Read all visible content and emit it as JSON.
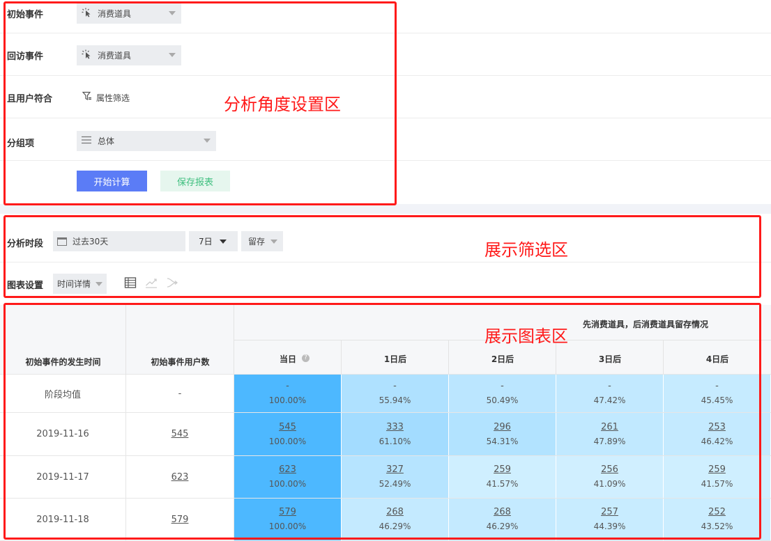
{
  "config": {
    "initial_event": {
      "label": "初始事件",
      "value": "消费道具"
    },
    "return_event": {
      "label": "回访事件",
      "value": "消费道具"
    },
    "user_filter": {
      "label": "且用户符合",
      "link": "属性筛选"
    },
    "group_by": {
      "label": "分组项",
      "value": "总体"
    },
    "buttons": {
      "calculate": "开始计算",
      "save": "保存报表"
    }
  },
  "filters": {
    "period": {
      "label": "分析时段",
      "range": "过去30天",
      "unit": "7日",
      "type": "留存"
    },
    "chart_setting": {
      "label": "图表设置",
      "mode": "时间详情"
    }
  },
  "table": {
    "group_title": "先消费道具，后消费道具留存情况",
    "headers": {
      "date": "初始事件的发生时间",
      "users": "初始事件用户数",
      "days": [
        "当日",
        "1日后",
        "2日后",
        "3日后",
        "4日后"
      ]
    },
    "rows": [
      {
        "date": "阶段均值",
        "users": "-",
        "linked": false,
        "cells": [
          {
            "count": "-",
            "pct": "100.00%"
          },
          {
            "count": "-",
            "pct": "55.94%"
          },
          {
            "count": "-",
            "pct": "50.49%"
          },
          {
            "count": "-",
            "pct": "47.42%"
          },
          {
            "count": "-",
            "pct": "45.45%"
          }
        ]
      },
      {
        "date": "2019-11-16",
        "users": "545",
        "linked": true,
        "cells": [
          {
            "count": "545",
            "pct": "100.00%"
          },
          {
            "count": "333",
            "pct": "61.10%"
          },
          {
            "count": "296",
            "pct": "54.31%"
          },
          {
            "count": "261",
            "pct": "47.89%"
          },
          {
            "count": "253",
            "pct": "46.42%"
          }
        ]
      },
      {
        "date": "2019-11-17",
        "users": "623",
        "linked": true,
        "cells": [
          {
            "count": "623",
            "pct": "100.00%"
          },
          {
            "count": "327",
            "pct": "52.49%"
          },
          {
            "count": "259",
            "pct": "41.57%"
          },
          {
            "count": "256",
            "pct": "41.09%"
          },
          {
            "count": "259",
            "pct": "41.57%"
          }
        ]
      },
      {
        "date": "2019-11-18",
        "users": "579",
        "linked": true,
        "cells": [
          {
            "count": "579",
            "pct": "100.00%"
          },
          {
            "count": "268",
            "pct": "46.29%"
          },
          {
            "count": "268",
            "pct": "46.29%"
          },
          {
            "count": "257",
            "pct": "44.39%"
          },
          {
            "count": "252",
            "pct": "43.52%"
          }
        ]
      }
    ]
  },
  "annotations": {
    "config_zone": "分析角度设置区",
    "filter_zone": "展示筛选区",
    "chart_zone": "展示图表区"
  },
  "colors": {
    "primary": "#5b7cf6",
    "save_text": "#3fbf7f",
    "annotation": "#ff1a1a",
    "heat_strong": "#4db8ff",
    "heat_weak": "#cfeeff"
  }
}
